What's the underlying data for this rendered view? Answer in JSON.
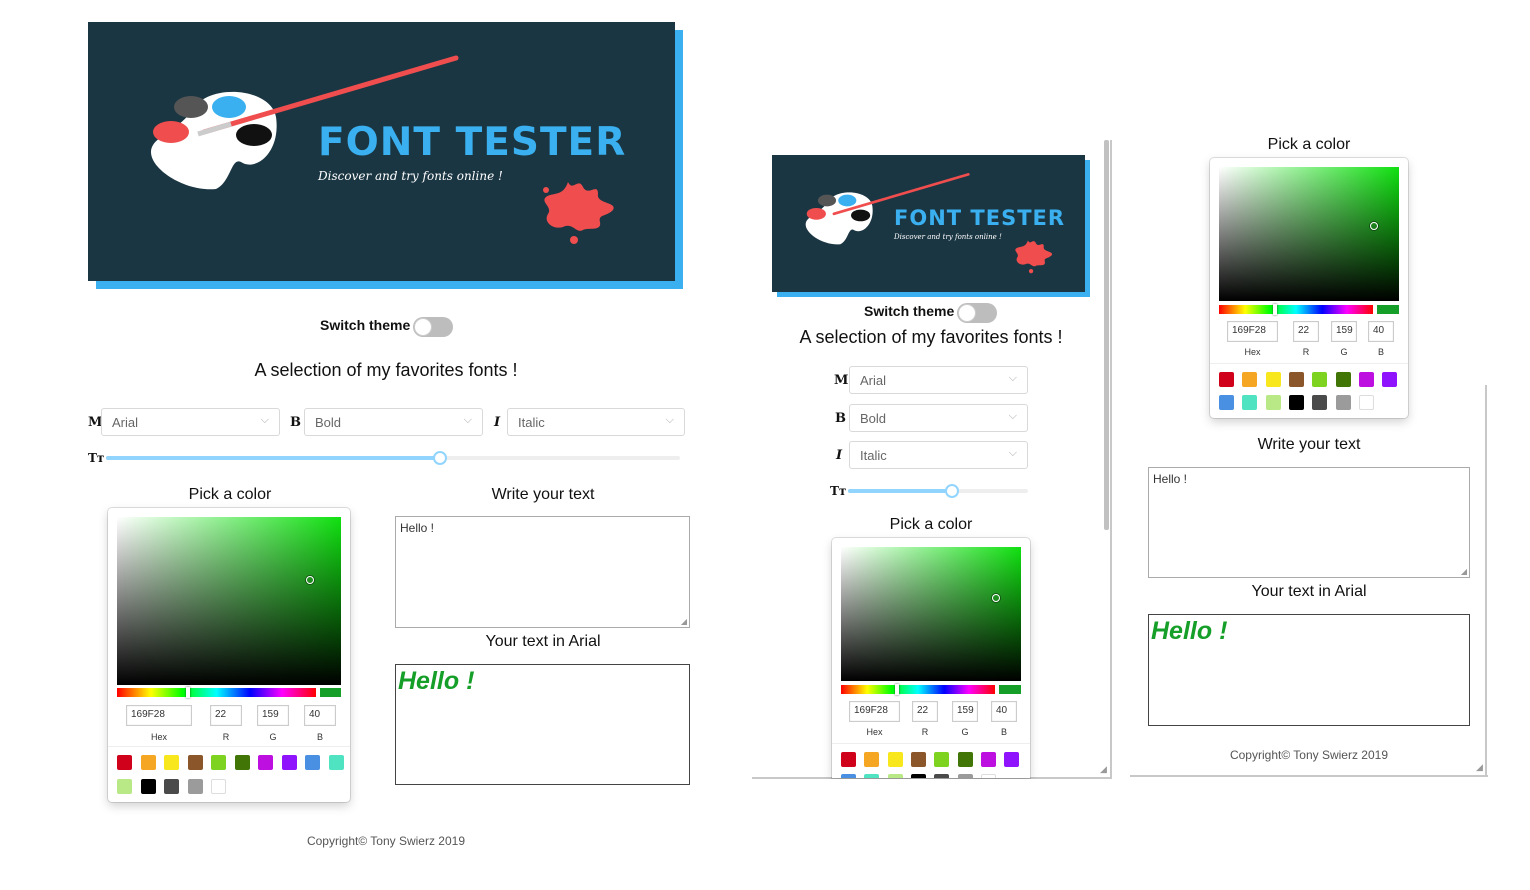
{
  "banner": {
    "title": "FONT TESTER",
    "subtitle": "Discover and try fonts online !",
    "colors": {
      "background": "#1b3643",
      "accent": "#3ab0f0",
      "paint_red": "#f04e4e"
    }
  },
  "theme_toggle": {
    "label": "Switch theme",
    "state": "off"
  },
  "heading": "A selection of my favorites fonts !",
  "selects": {
    "font": {
      "icon": "M",
      "value": "Arial"
    },
    "weight": {
      "icon": "B",
      "value": "Bold"
    },
    "style": {
      "icon": "I",
      "value": "Italic"
    }
  },
  "size_slider": {
    "icon": "TT",
    "level_fraction": 0.58
  },
  "color_picker": {
    "title": "Pick a color",
    "hex": "169F28",
    "r": "22",
    "g": "159",
    "b": "40",
    "labels": {
      "hex": "Hex",
      "r": "R",
      "g": "G",
      "b": "B"
    },
    "selected_color": "#169f28",
    "swatches": [
      "#d0021b",
      "#f5a623",
      "#f8e71c",
      "#8b572a",
      "#7ed321",
      "#417505",
      "#bd10e0",
      "#9013fe",
      "#4a90e2",
      "#50e3c2",
      "#b8e986",
      "#000000",
      "#4a4a4a",
      "#9b9b9b",
      "#ffffff"
    ]
  },
  "text_input": {
    "title": "Write your text",
    "value": "Hello !"
  },
  "result": {
    "title": "Your text in Arial",
    "text": "Hello !"
  },
  "footer": {
    "copyright": "Copyright© Tony Swierz 2019"
  }
}
